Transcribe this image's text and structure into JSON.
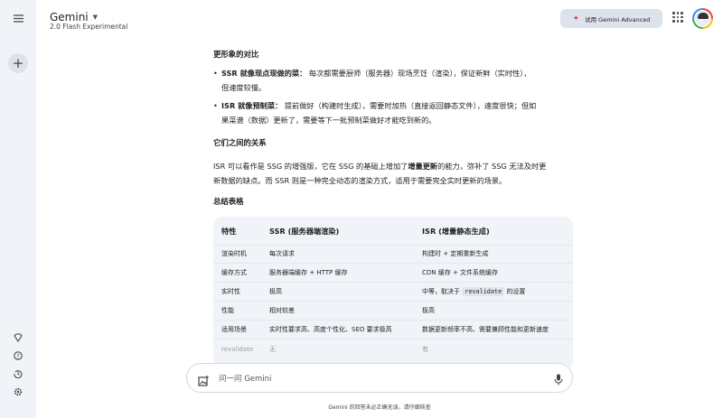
{
  "header": {
    "title": "Gemini",
    "subtitle": "2.0 Flash Experimental",
    "advanced_button": "试用 Gemini Advanced"
  },
  "content": {
    "heading1": "更形象的对比",
    "bullets": [
      {
        "bold": "SSR 就像现点现做的菜：",
        "text": " 每次都需要厨师（服务器）现场烹饪（渲染），保证新鲜（实时性），",
        "cont": "但速度较慢。"
      },
      {
        "bold": "ISR 就像预制菜：",
        "text": " 提前做好（构建时生成），需要时加热（直接返回静态文件），速度很快；但如",
        "cont": "果菜谱（数据）更新了，需要等下一批预制菜做好才能吃到新的。"
      }
    ],
    "heading2": "它们之间的关系",
    "para_a": "ISR 可以看作是 SSG 的增强版，它在 SSG 的基础上增加了",
    "para_bold": "增量更新",
    "para_b": "的能力，弥补了 SSG 无法及时更",
    "para_line2": "新数据的缺点。而 SSR 则是一种完全动态的渲染方式，适用于需要完全实时更新的场景。",
    "heading3": "总结表格"
  },
  "table": {
    "headers": [
      "特性",
      "SSR (服务器端渲染)",
      "ISR (增量静态生成)"
    ],
    "rows": [
      [
        "渲染时机",
        "每次请求",
        "构建时 + 定期重新生成"
      ],
      [
        "缓存方式",
        "服务器端缓存 + HTTP 缓存",
        "CDN 缓存 + 文件系统缓存"
      ],
      [
        "实时性",
        "极高",
        "中等，取决于 ",
        "revalidate",
        " 的设置"
      ],
      [
        "性能",
        "相对较差",
        "极高"
      ],
      [
        "适用场景",
        "实时性要求高、高度个性化、SEO 要求极高",
        "数据更新频率不高、需要兼顾性能和更新速度"
      ],
      [
        "revalidate",
        "无",
        "有"
      ]
    ]
  },
  "input": {
    "placeholder": "问一问 Gemini"
  },
  "footer": "Gemini 的回答未必正确无误，请仔细核查"
}
